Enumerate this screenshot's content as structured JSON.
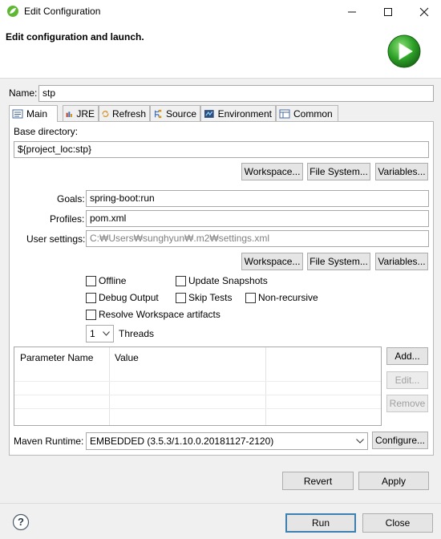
{
  "window": {
    "title": "Edit Configuration"
  },
  "header": {
    "description": "Edit configuration and launch."
  },
  "name": {
    "label": "Name:",
    "value": "stp"
  },
  "tabs": [
    {
      "label": "Main",
      "icon": "main-tab-icon"
    },
    {
      "label": "JRE",
      "icon": "jre-icon"
    },
    {
      "label": "Refresh",
      "icon": "refresh-icon"
    },
    {
      "label": "Source",
      "icon": "source-icon"
    },
    {
      "label": "Environment",
      "icon": "environment-icon"
    },
    {
      "label": "Common",
      "icon": "common-icon"
    }
  ],
  "main": {
    "base_dir_label": "Base directory:",
    "base_dir_value": "${project_loc:stp}",
    "workspace_btn": "Workspace...",
    "filesystem_btn": "File System...",
    "variables_btn": "Variables...",
    "goals_label": "Goals:",
    "goals_value": "spring-boot:run",
    "profiles_label": "Profiles:",
    "profiles_value": "pom.xml",
    "user_settings_label": "User settings:",
    "user_settings_value": "C:₩Users₩sunghyun₩.m2₩settings.xml",
    "checkboxes": {
      "offline": "Offline",
      "update_snapshots": "Update Snapshots",
      "debug_output": "Debug Output",
      "skip_tests": "Skip Tests",
      "non_recursive": "Non-recursive",
      "resolve_workspace": "Resolve Workspace artifacts"
    },
    "threads_value": "1",
    "threads_label": "Threads",
    "table": {
      "col_name": "Parameter Name",
      "col_value": "Value"
    },
    "add_btn": "Add...",
    "edit_btn": "Edit...",
    "remove_btn": "Remove",
    "runtime_label": "Maven Runtime:",
    "runtime_value": "EMBEDDED (3.5.3/1.10.0.20181127-2120)",
    "configure_btn": "Configure..."
  },
  "footer": {
    "revert": "Revert",
    "apply": "Apply",
    "run": "Run",
    "close": "Close",
    "help_symbol": "?"
  },
  "colors": {
    "accent_green": "#2ea329",
    "default_button_border": "#3c7fb1"
  }
}
